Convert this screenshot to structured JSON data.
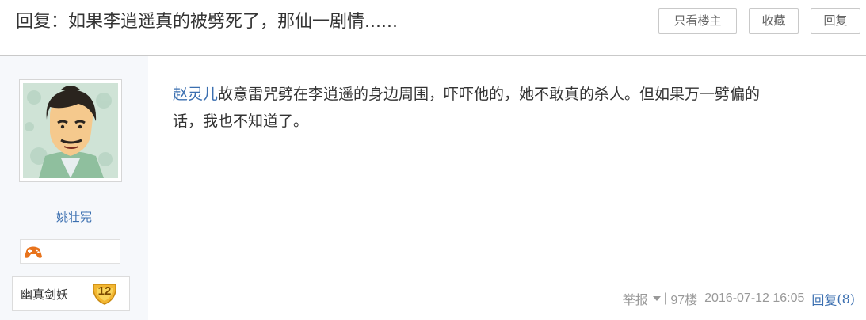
{
  "thread": {
    "title": "回复：如果李逍遥真的被劈死了，那仙一剧情......"
  },
  "toolbar": {
    "only_op_label": "只看楼主",
    "favorite_label": "收藏",
    "reply_label": "回复"
  },
  "author": {
    "name": "姚壮宪",
    "avatar_icon": "avatar-portrait",
    "badge_icon": "game-controller-icon",
    "level_title": "幽真剑妖",
    "level_number": "12"
  },
  "post": {
    "linked_name": "赵灵儿",
    "text_line1": "故意雷咒劈在李逍遥的身边周围，吓吓他的，她不敢真的杀人。但如果万一劈偏的",
    "text_line2": "话，我也不知道了。"
  },
  "footer": {
    "report_label": "举报",
    "separator": "|",
    "floor": "97楼",
    "timestamp": "2016-07-12 16:05",
    "reply_label": "回复",
    "reply_count": "(8)"
  },
  "colors": {
    "link": "#3b6fb0",
    "sidebar_bg": "#f6f8fb",
    "muted": "#999999"
  }
}
